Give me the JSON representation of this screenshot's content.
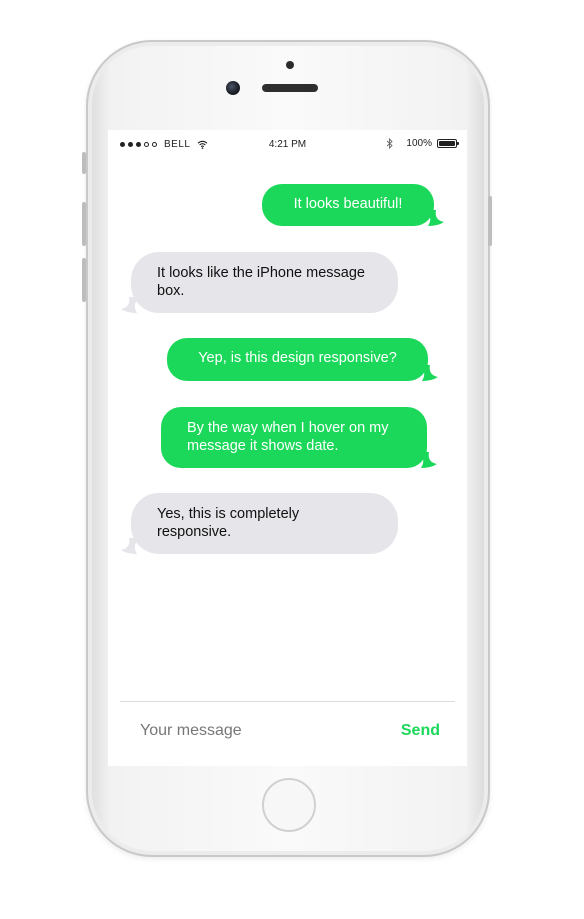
{
  "status_bar": {
    "carrier": "BELL",
    "time": "4:21 PM",
    "battery": "100%"
  },
  "messages": [
    {
      "type": "sent",
      "text": "It looks beautiful!"
    },
    {
      "type": "received",
      "text": "It looks like the iPhone message box."
    },
    {
      "type": "sent",
      "text": "Yep, is this design responsive?"
    },
    {
      "type": "sent",
      "text": "By the way when I hover on my message it shows date."
    },
    {
      "type": "received",
      "text": "Yes, this is completely responsive."
    }
  ],
  "composer": {
    "placeholder": "Your message",
    "value": "",
    "send_label": "Send"
  },
  "colors": {
    "sent_bubble": "#1cd85a",
    "received_bubble": "#e5e5ea",
    "send_text": "#1cd85a"
  }
}
